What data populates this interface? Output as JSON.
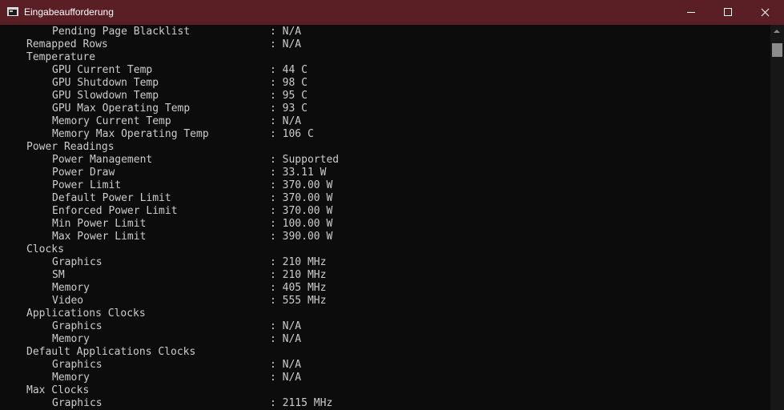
{
  "window": {
    "title": "Eingabeaufforderung",
    "icon": "command-prompt-icon",
    "titlebar_color": "#5a1e25",
    "console_background": "#0c0c0c",
    "console_text_color": "#cccccc",
    "controls": {
      "minimize": "minimize-icon",
      "maximize": "maximize-icon",
      "close": "close-icon"
    }
  },
  "lines": [
    {
      "label": "Pending Page Blacklist",
      "level": 2,
      "value": ": N/A"
    },
    {
      "label": "Remapped Rows",
      "level": 1,
      "value": ": N/A"
    },
    {
      "label": "Temperature",
      "level": 1,
      "value": ""
    },
    {
      "label": "GPU Current Temp",
      "level": 2,
      "value": ": 44 C"
    },
    {
      "label": "GPU Shutdown Temp",
      "level": 2,
      "value": ": 98 C"
    },
    {
      "label": "GPU Slowdown Temp",
      "level": 2,
      "value": ": 95 C"
    },
    {
      "label": "GPU Max Operating Temp",
      "level": 2,
      "value": ": 93 C"
    },
    {
      "label": "Memory Current Temp",
      "level": 2,
      "value": ": N/A"
    },
    {
      "label": "Memory Max Operating Temp",
      "level": 2,
      "value": ": 106 C"
    },
    {
      "label": "Power Readings",
      "level": 1,
      "value": ""
    },
    {
      "label": "Power Management",
      "level": 2,
      "value": ": Supported"
    },
    {
      "label": "Power Draw",
      "level": 2,
      "value": ": 33.11 W"
    },
    {
      "label": "Power Limit",
      "level": 2,
      "value": ": 370.00 W"
    },
    {
      "label": "Default Power Limit",
      "level": 2,
      "value": ": 370.00 W"
    },
    {
      "label": "Enforced Power Limit",
      "level": 2,
      "value": ": 370.00 W"
    },
    {
      "label": "Min Power Limit",
      "level": 2,
      "value": ": 100.00 W"
    },
    {
      "label": "Max Power Limit",
      "level": 2,
      "value": ": 390.00 W"
    },
    {
      "label": "Clocks",
      "level": 1,
      "value": ""
    },
    {
      "label": "Graphics",
      "level": 2,
      "value": ": 210 MHz"
    },
    {
      "label": "SM",
      "level": 2,
      "value": ": 210 MHz"
    },
    {
      "label": "Memory",
      "level": 2,
      "value": ": 405 MHz"
    },
    {
      "label": "Video",
      "level": 2,
      "value": ": 555 MHz"
    },
    {
      "label": "Applications Clocks",
      "level": 1,
      "value": ""
    },
    {
      "label": "Graphics",
      "level": 2,
      "value": ": N/A"
    },
    {
      "label": "Memory",
      "level": 2,
      "value": ": N/A"
    },
    {
      "label": "Default Applications Clocks",
      "level": 1,
      "value": ""
    },
    {
      "label": "Graphics",
      "level": 2,
      "value": ": N/A"
    },
    {
      "label": "Memory",
      "level": 2,
      "value": ": N/A"
    },
    {
      "label": "Max Clocks",
      "level": 1,
      "value": ""
    },
    {
      "label": "Graphics",
      "level": 2,
      "value": ": 2115 MHz"
    }
  ]
}
